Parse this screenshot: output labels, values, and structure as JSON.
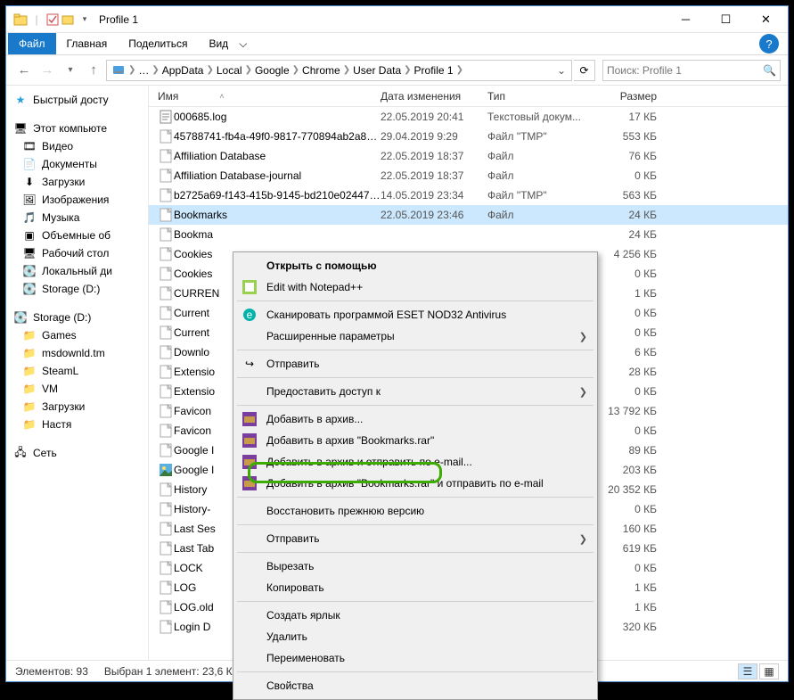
{
  "window": {
    "title": "Profile 1"
  },
  "tabs": {
    "file": "Файл",
    "home": "Главная",
    "share": "Поделиться",
    "view": "Вид"
  },
  "breadcrumb": [
    "AppData",
    "Local",
    "Google",
    "Chrome",
    "User Data",
    "Profile 1"
  ],
  "search": {
    "placeholder": "Поиск: Profile 1"
  },
  "columns": {
    "name": "Имя",
    "date": "Дата изменения",
    "type": "Тип",
    "size": "Размер"
  },
  "sidebar": {
    "quick": "Быстрый досту",
    "thispc": "Этот компьюте",
    "items1": [
      "Видео",
      "Документы",
      "Загрузки",
      "Изображения",
      "Музыка",
      "Объемные об",
      "Рабочий стол",
      "Локальный ди",
      "Storage (D:)"
    ],
    "storage": "Storage (D:)",
    "items2": [
      "Games",
      "msdownld.tm",
      "SteamL",
      "VM",
      "Загрузки",
      "Настя"
    ],
    "network": "Сеть"
  },
  "files": [
    {
      "icon": "txt",
      "name": "000685.log",
      "date": "22.05.2019 20:41",
      "type": "Текстовый докум...",
      "size": "17 КБ"
    },
    {
      "icon": "file",
      "name": "45788741-fb4a-49f0-9817-770894ab2a80.t...",
      "date": "29.04.2019 9:29",
      "type": "Файл \"TMP\"",
      "size": "553 КБ"
    },
    {
      "icon": "file",
      "name": "Affiliation Database",
      "date": "22.05.2019 18:37",
      "type": "Файл",
      "size": "76 КБ"
    },
    {
      "icon": "file",
      "name": "Affiliation Database-journal",
      "date": "22.05.2019 18:37",
      "type": "Файл",
      "size": "0 КБ"
    },
    {
      "icon": "file",
      "name": "b2725a69-f143-415b-9145-bd210e02447a...",
      "date": "14.05.2019 23:34",
      "type": "Файл \"TMP\"",
      "size": "563 КБ"
    },
    {
      "icon": "file",
      "name": "Bookmarks",
      "date": "22.05.2019 23:46",
      "type": "Файл",
      "size": "24 КБ",
      "selected": true
    },
    {
      "icon": "file",
      "name": "Bookma",
      "date": "",
      "type": "",
      "size": "24 КБ"
    },
    {
      "icon": "file",
      "name": "Cookies",
      "date": "",
      "type": "",
      "size": "4 256 КБ"
    },
    {
      "icon": "file",
      "name": "Cookies",
      "date": "",
      "type": "",
      "size": "0 КБ"
    },
    {
      "icon": "file",
      "name": "CURREN",
      "date": "",
      "type": "",
      "size": "1 КБ"
    },
    {
      "icon": "file",
      "name": "Current",
      "date": "",
      "type": "",
      "size": "0 КБ"
    },
    {
      "icon": "file",
      "name": "Current",
      "date": "",
      "type": "",
      "size": "0 КБ"
    },
    {
      "icon": "file",
      "name": "Downlo",
      "date": "",
      "type": "",
      "size": "6 КБ"
    },
    {
      "icon": "file",
      "name": "Extensio",
      "date": "",
      "type": "",
      "size": "28 КБ"
    },
    {
      "icon": "file",
      "name": "Extensio",
      "date": "",
      "type": "",
      "size": "0 КБ"
    },
    {
      "icon": "file",
      "name": "Favicon",
      "date": "",
      "type": "",
      "size": "13 792 КБ"
    },
    {
      "icon": "file",
      "name": "Favicon",
      "date": "",
      "type": "",
      "size": "0 КБ"
    },
    {
      "icon": "file",
      "name": "Google I",
      "date": "",
      "type": "",
      "size": "89 КБ"
    },
    {
      "icon": "img",
      "name": "Google I",
      "date": "",
      "type": "",
      "size": "203 КБ"
    },
    {
      "icon": "file",
      "name": "History",
      "date": "",
      "type": "",
      "size": "20 352 КБ"
    },
    {
      "icon": "file",
      "name": "History-",
      "date": "",
      "type": "",
      "size": "0 КБ"
    },
    {
      "icon": "file",
      "name": "Last Ses",
      "date": "",
      "type": "",
      "size": "160 КБ"
    },
    {
      "icon": "file",
      "name": "Last Tab",
      "date": "",
      "type": "",
      "size": "619 КБ"
    },
    {
      "icon": "file",
      "name": "LOCK",
      "date": "",
      "type": "",
      "size": "0 КБ"
    },
    {
      "icon": "file",
      "name": "LOG",
      "date": "",
      "type": "",
      "size": "1 КБ"
    },
    {
      "icon": "file",
      "name": "LOG.old",
      "date": "",
      "type": "",
      "size": "1 КБ"
    },
    {
      "icon": "file",
      "name": "Login D",
      "date": "",
      "type": "",
      "size": "320 КБ"
    }
  ],
  "context": {
    "open_with": "Открыть с помощью",
    "edit_npp": "Edit with Notepad++",
    "eset": "Сканировать программой ESET NOD32 Antivirus",
    "advanced": "Расширенные параметры",
    "send1": "Отправить",
    "share_access": "Предоставить доступ к",
    "rar_add": "Добавить в архив...",
    "rar_add_name": "Добавить в архив \"Bookmarks.rar\"",
    "rar_email": "Добавить в архив и отправить по e-mail...",
    "rar_email_name": "Добавить в архив \"Bookmarks.rar\" и отправить по e-mail",
    "restore": "Восстановить прежнюю версию",
    "send2": "Отправить",
    "cut": "Вырезать",
    "copy": "Копировать",
    "shortcut": "Создать ярлык",
    "delete": "Удалить",
    "rename": "Переименовать",
    "properties": "Свойства"
  },
  "status": {
    "count": "Элементов: 93",
    "selected": "Выбран 1 элемент: 23,6 КБ"
  }
}
